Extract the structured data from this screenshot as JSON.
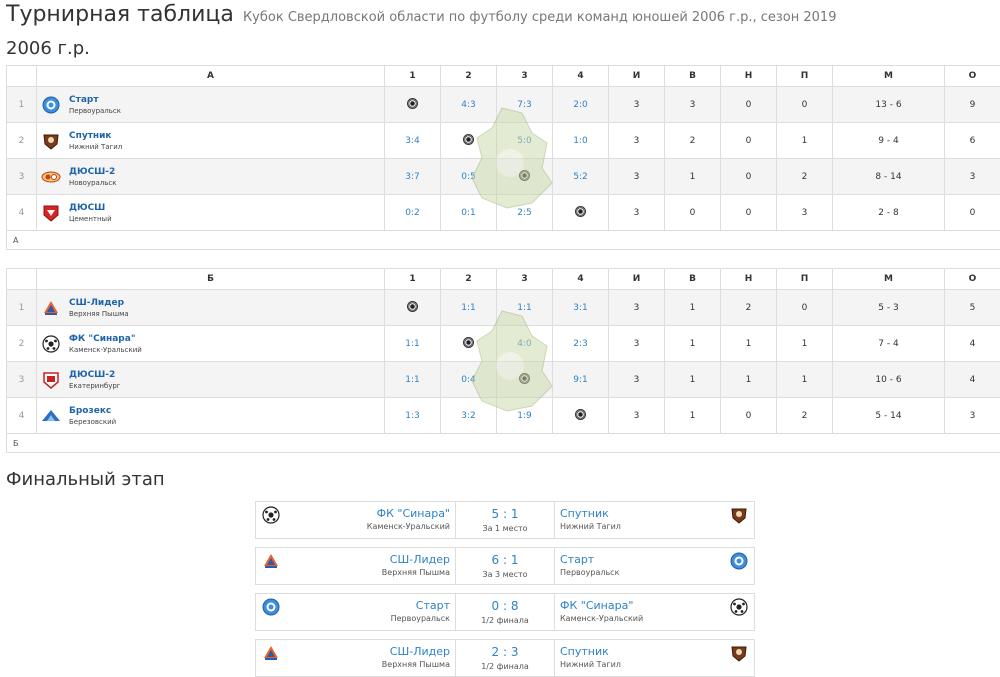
{
  "header": {
    "title": "Турнирная таблица",
    "subtitle": "Кубок Свердловской области по футболу среди команд юношей 2006 г.р., сезон 2019"
  },
  "season_title": "2006 г.р.",
  "columns": [
    "1",
    "2",
    "3",
    "4",
    "И",
    "В",
    "Н",
    "П",
    "М",
    "О"
  ],
  "groups": [
    {
      "name": "А",
      "footer": "А",
      "rows": [
        {
          "pos": "1",
          "logo": "start-logo-icon",
          "team": "Старт",
          "city": "Первоуральск",
          "results": [
            "self",
            "4:3",
            "7:3",
            "2:0"
          ],
          "played": "3",
          "won": "3",
          "drawn": "0",
          "lost": "0",
          "goals": "13 - 6",
          "points": "9"
        },
        {
          "pos": "2",
          "logo": "sputnik-logo-icon",
          "team": "Спутник",
          "city": "Нижний Тагил",
          "results": [
            "3:4",
            "self",
            "5:0",
            "1:0"
          ],
          "played": "3",
          "won": "2",
          "drawn": "0",
          "lost": "1",
          "goals": "9 - 4",
          "points": "6"
        },
        {
          "pos": "3",
          "logo": "dyussh2-novouralsk-logo-icon",
          "team": "ДЮСШ-2",
          "city": "Новоуральск",
          "results": [
            "3:7",
            "0:5",
            "self",
            "5:2"
          ],
          "played": "3",
          "won": "1",
          "drawn": "0",
          "lost": "2",
          "goals": "8 - 14",
          "points": "3"
        },
        {
          "pos": "4",
          "logo": "dyussh-cementny-logo-icon",
          "team": "ДЮСШ",
          "city": "Цементный",
          "results": [
            "0:2",
            "0:1",
            "2:5",
            "self"
          ],
          "played": "3",
          "won": "0",
          "drawn": "0",
          "lost": "3",
          "goals": "2 - 8",
          "points": "0"
        }
      ]
    },
    {
      "name": "Б",
      "footer": "Б",
      "rows": [
        {
          "pos": "1",
          "logo": "ssh-lider-logo-icon",
          "team": "СШ-Лидер",
          "city": "Верхняя Пышма",
          "results": [
            "self",
            "1:1",
            "1:1",
            "3:1"
          ],
          "played": "3",
          "won": "1",
          "drawn": "2",
          "lost": "0",
          "goals": "5 - 3",
          "points": "5"
        },
        {
          "pos": "2",
          "logo": "sinara-logo-icon",
          "team": "ФК \"Синара\"",
          "city": "Каменск-Уральский",
          "results": [
            "1:1",
            "self",
            "4:0",
            "2:3"
          ],
          "played": "3",
          "won": "1",
          "drawn": "1",
          "lost": "1",
          "goals": "7 - 4",
          "points": "4"
        },
        {
          "pos": "3",
          "logo": "dyussh2-ekb-logo-icon",
          "team": "ДЮСШ-2",
          "city": "Екатеринбург",
          "results": [
            "1:1",
            "0:4",
            "self",
            "9:1"
          ],
          "played": "3",
          "won": "1",
          "drawn": "1",
          "lost": "1",
          "goals": "10 - 6",
          "points": "4"
        },
        {
          "pos": "4",
          "logo": "brozeks-logo-icon",
          "team": "Брозекс",
          "city": "Березовский",
          "results": [
            "1:3",
            "3:2",
            "1:9",
            "self"
          ],
          "played": "3",
          "won": "1",
          "drawn": "0",
          "lost": "2",
          "goals": "5 - 14",
          "points": "3"
        }
      ]
    }
  ],
  "final": {
    "title": "Финальный этап",
    "matches": [
      {
        "home": "ФК \"Синара\"",
        "home_city": "Каменск-Уральский",
        "home_logo": "sinara-logo-icon",
        "score": "5 : 1",
        "stage": "За 1 место",
        "away": "Спутник",
        "away_city": "Нижний Тагил",
        "away_logo": "sputnik-logo-icon"
      },
      {
        "home": "СШ-Лидер",
        "home_city": "Верхняя Пышма",
        "home_logo": "ssh-lider-logo-icon",
        "score": "6 : 1",
        "stage": "За 3 место",
        "away": "Старт",
        "away_city": "Первоуральск",
        "away_logo": "start-logo-icon"
      },
      {
        "home": "Старт",
        "home_city": "Первоуральск",
        "home_logo": "start-logo-icon",
        "score": "0 : 8",
        "stage": "1/2 финала",
        "away": "ФК \"Синара\"",
        "away_city": "Каменск-Уральский",
        "away_logo": "sinara-logo-icon"
      },
      {
        "home": "СШ-Лидер",
        "home_city": "Верхняя Пышма",
        "home_logo": "ssh-lider-logo-icon",
        "score": "2 : 3",
        "stage": "1/2 финала",
        "away": "Спутник",
        "away_city": "Нижний Тагил",
        "away_logo": "sputnik-logo-icon"
      }
    ]
  },
  "colors": {
    "link": "#2d82c8",
    "team_name": "#1f64a8",
    "row_alt": "#f4f4f4",
    "border": "#dddddd"
  }
}
